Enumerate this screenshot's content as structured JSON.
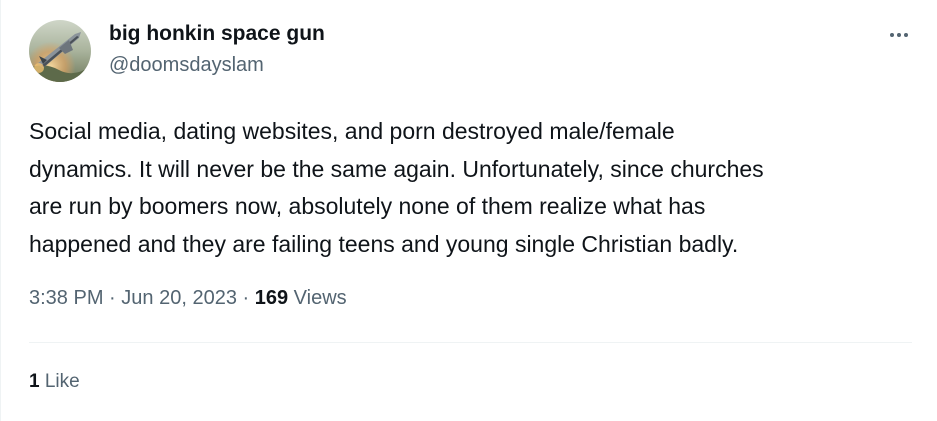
{
  "author": {
    "display_name": "big honkin space gun",
    "handle": "@doomsdayslam",
    "avatar_icon": "spaceship-avatar"
  },
  "more_icon": "more-horizontal-icon",
  "tweet": {
    "text_lines": [
      "Social media, dating websites, and porn destroyed male/female",
      "dynamics. It will never be the same again. Unfortunately, since churches",
      "are run by boomers now, absolutely none of them realize what has",
      "happened and they are failing teens and young single Christian badly."
    ],
    "time": "3:38 PM",
    "separator": "·",
    "date": "Jun 20, 2023",
    "views_count": "169",
    "views_label": "Views"
  },
  "engagement": {
    "likes_count": "1",
    "likes_label": "Like"
  },
  "colors": {
    "text": "#0f1419",
    "secondary": "#536471",
    "divider": "#eff3f4"
  }
}
